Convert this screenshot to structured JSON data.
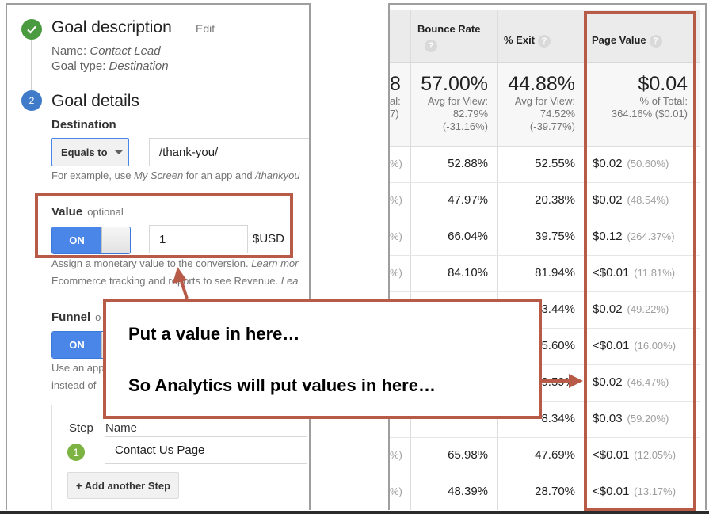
{
  "goal_setup": {
    "step1": {
      "icon": "check-icon",
      "title": "Goal description",
      "edit_label": "Edit",
      "name_label": "Name:",
      "name_value": "Contact Lead",
      "type_label": "Goal type:",
      "type_value": "Destination"
    },
    "step2": {
      "number": "2",
      "title": "Goal details"
    },
    "destination": {
      "label": "Destination",
      "match_type": "Equals to",
      "value": "/thank-you/",
      "hint_prefix": "For example, use ",
      "hint_em1": "My Screen",
      "hint_mid": " for an app and ",
      "hint_em2": "/thankyou"
    },
    "value": {
      "label": "Value",
      "optional": "optional",
      "toggle": "ON",
      "amount": "1",
      "currency": "$USD",
      "hint1_prefix": "Assign a monetary value to the conversion. ",
      "hint1_em": "Learn mor",
      "hint2_prefix": "Ecommerce tracking and reports to see Revenue. ",
      "hint2_em": "Lea"
    },
    "funnel": {
      "label": "Funnel",
      "optional": "o",
      "toggle": "ON",
      "hint1": "Use an app",
      "hint2": "instead of",
      "step_col": "Step",
      "name_col": "Name",
      "step_number": "1",
      "step_name": "Contact Us Page",
      "add_step": "+ Add another Step"
    }
  },
  "report_table": {
    "columns": [
      {
        "label": "Bounce Rate",
        "help": "?"
      },
      {
        "label": "% Exit",
        "help": "?"
      },
      {
        "label": "Page Value",
        "help": "?"
      }
    ],
    "summary": {
      "partial_big": "8",
      "partial_sub1": "al:",
      "partial_sub2": "7)",
      "bounce_rate": {
        "value": "57.00%",
        "line1": "Avg for View:",
        "line2": "82.79%",
        "line3": "(-31.16%)"
      },
      "exit": {
        "value": "44.88%",
        "line1": "Avg for View:",
        "line2": "74.52%",
        "line3": "(-39.77%)"
      },
      "page_value": {
        "value": "$0.04",
        "line1": "% of Total:",
        "line2": "364.16% ($0.01)"
      }
    },
    "rows": [
      {
        "partial": "%)",
        "bounce_rate": "52.88%",
        "exit": "52.55%",
        "page_value": "$0.02",
        "pct": "(50.60%)"
      },
      {
        "partial": "%)",
        "bounce_rate": "47.97%",
        "exit": "20.38%",
        "page_value": "$0.02",
        "pct": "(48.54%)"
      },
      {
        "partial": "%)",
        "bounce_rate": "66.04%",
        "exit": "39.75%",
        "page_value": "$0.12",
        "pct": "(264.37%)"
      },
      {
        "partial": "%)",
        "bounce_rate": "84.10%",
        "exit": "81.94%",
        "page_value": "<$0.01",
        "pct": "(11.81%)"
      },
      {
        "partial": "",
        "bounce_rate": "",
        "exit": "3.44%",
        "page_value": "$0.02",
        "pct": "(49.22%)"
      },
      {
        "partial": "",
        "bounce_rate": "",
        "exit": "5.60%",
        "page_value": "<$0.01",
        "pct": "(16.00%)"
      },
      {
        "partial": "",
        "bounce_rate": "",
        "exit": "9.59%",
        "page_value": "$0.02",
        "pct": "(46.47%)"
      },
      {
        "partial": "",
        "bounce_rate": "",
        "exit": "8.34%",
        "page_value": "$0.03",
        "pct": "(59.20%)"
      },
      {
        "partial": "%)",
        "bounce_rate": "65.98%",
        "exit": "47.69%",
        "page_value": "<$0.01",
        "pct": "(12.05%)"
      },
      {
        "partial": "%)",
        "bounce_rate": "48.39%",
        "exit": "28.70%",
        "page_value": "<$0.01",
        "pct": "(13.17%)"
      }
    ]
  },
  "annotation": {
    "line1": "Put a value in here…",
    "line2": "So Analytics will put values in here…",
    "color": "#b75b48"
  }
}
